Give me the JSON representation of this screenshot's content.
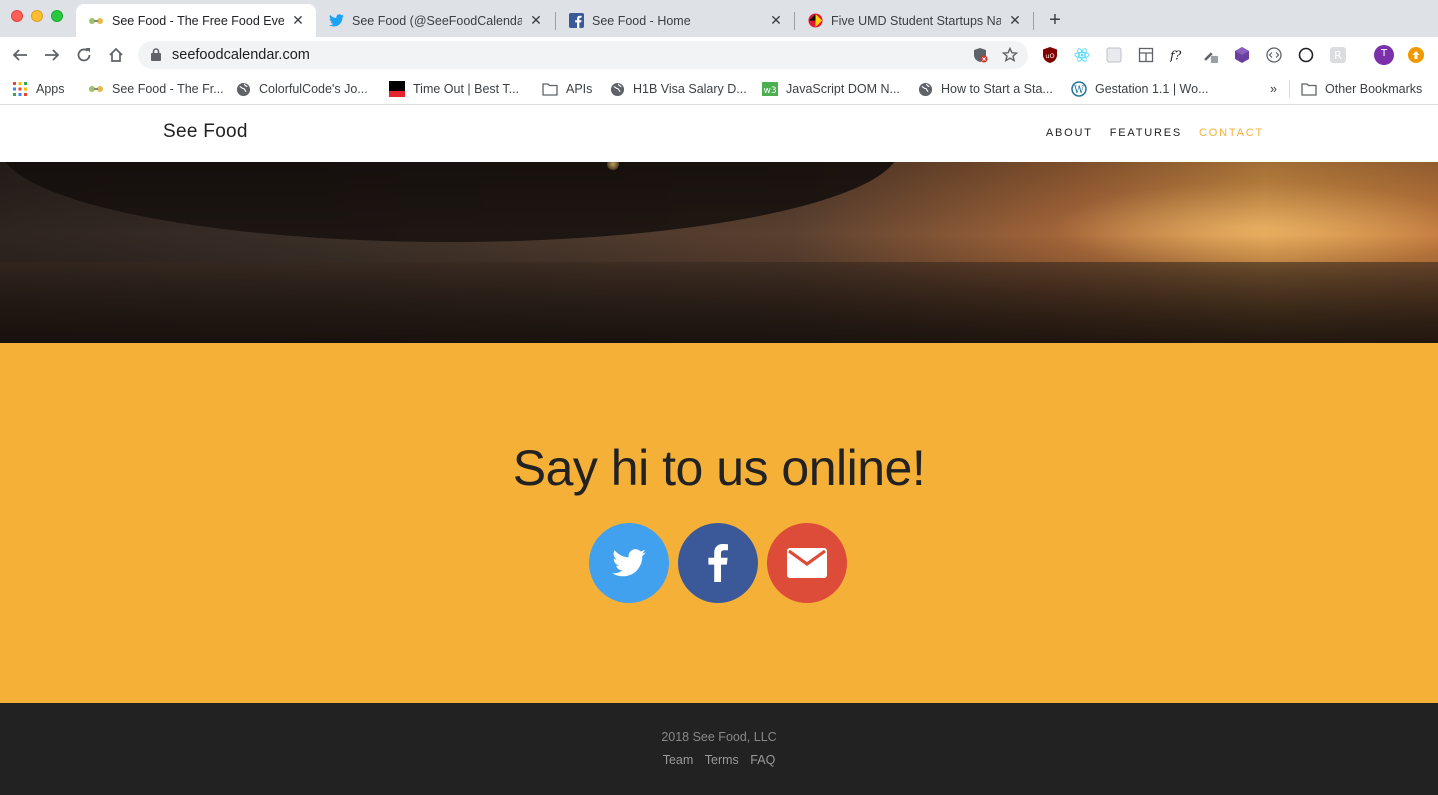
{
  "browser": {
    "tabs": [
      {
        "title": "See Food - The Free Food Ever",
        "active": true,
        "favicon": "seefood-icon"
      },
      {
        "title": "See Food (@SeeFoodCalendar)",
        "active": false,
        "favicon": "twitter-icon"
      },
      {
        "title": "See Food - Home",
        "active": false,
        "favicon": "facebook-icon"
      },
      {
        "title": "Five UMD Student Startups Na",
        "active": false,
        "favicon": "umd-icon"
      }
    ],
    "url": "seefoodcalendar.com",
    "profile_initial": "T",
    "bookmarks": [
      {
        "label": "Apps",
        "icon": "apps-grid-icon"
      },
      {
        "label": "See Food - The Fr...",
        "icon": "seefood-icon"
      },
      {
        "label": "ColorfulCode's Jo...",
        "icon": "globe-icon"
      },
      {
        "label": "Time Out | Best T...",
        "icon": "timeout-icon"
      },
      {
        "label": "APIs",
        "icon": "folder-icon"
      },
      {
        "label": "H1B Visa Salary D...",
        "icon": "globe-icon"
      },
      {
        "label": "JavaScript DOM N...",
        "icon": "w3-icon"
      },
      {
        "label": "How to Start a Sta...",
        "icon": "globe-icon"
      },
      {
        "label": "Gestation 1.1 | Wo...",
        "icon": "wordpress-icon"
      }
    ],
    "bookmarks_overflow": "»",
    "other_bookmarks": "Other Bookmarks"
  },
  "site": {
    "brand": "See Food",
    "nav": [
      {
        "label": "About",
        "active": false
      },
      {
        "label": "Features",
        "active": false
      },
      {
        "label": "Contact",
        "active": true
      }
    ],
    "contact": {
      "heading": "Say hi to us online!",
      "social": [
        {
          "name": "twitter",
          "color": "#41a1ef"
        },
        {
          "name": "facebook",
          "color": "#3b5998"
        },
        {
          "name": "email",
          "color": "#dd4b39"
        }
      ]
    },
    "footer": {
      "copyright": "2018 See Food, LLC",
      "links": [
        "Team",
        "Terms",
        "FAQ"
      ]
    }
  },
  "colors": {
    "accent": "#f5b037",
    "footer_bg": "#222222"
  }
}
